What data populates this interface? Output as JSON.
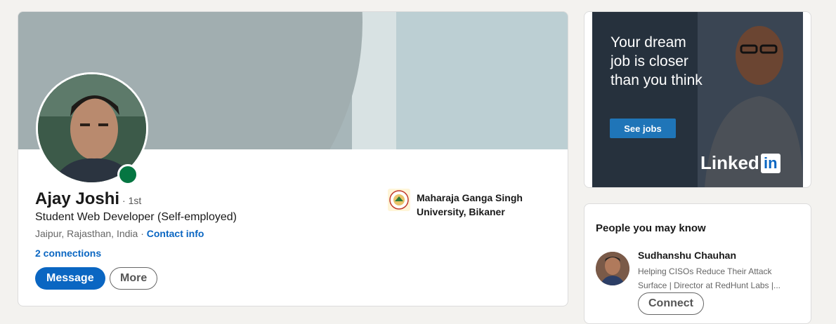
{
  "profile": {
    "name": "Ajay Joshi",
    "degree": "· 1st",
    "headline": "Student Web Developer (Self-employed)",
    "location": "Jaipur, Rajasthan, India · ",
    "contact_info": "Contact info",
    "connections": "2 connections",
    "message_label": "Message",
    "more_label": "More",
    "education": "Maharaja Ganga Singh University, Bikaner",
    "online_color": "#057642"
  },
  "ad": {
    "headline": "Your dream job is closer than you think",
    "cta": "See jobs",
    "brand": "Linked",
    "brand_in": "in"
  },
  "people": {
    "title": "People you may know",
    "items": [
      {
        "name": "Sudhanshu Chauhan",
        "description": "Helping CISOs Reduce Their Attack Surface | Director at RedHunt Labs |...",
        "action": "Connect"
      }
    ]
  },
  "colors": {
    "accent": "#0a66c2",
    "page_bg": "#f3f2ef"
  }
}
